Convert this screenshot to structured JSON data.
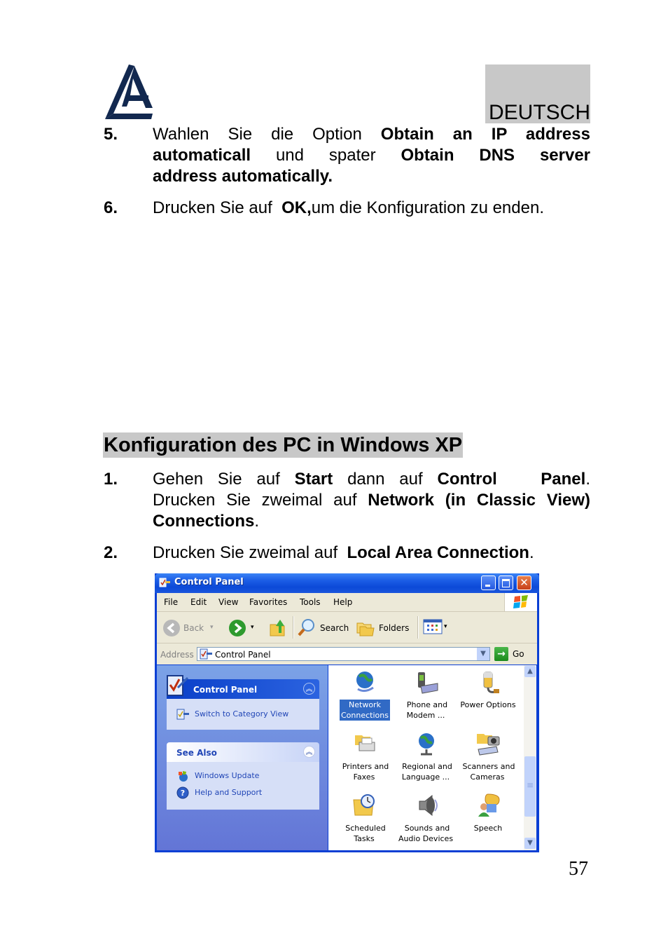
{
  "header": {
    "language": "DEUTSCH",
    "logo": "atlantis-logo"
  },
  "steps_top": [
    {
      "number": "5.",
      "lines": [
        [
          {
            "t": "Wahlen Sie die Option ",
            "b": false
          },
          {
            "t": "Obtain an IP address",
            "b": true
          }
        ],
        [
          {
            "t": "automaticall",
            "b": true
          },
          {
            "t": " und spater ",
            "b": false
          },
          {
            "t": "Obtain DNS server",
            "b": true
          }
        ],
        [
          {
            "t": "address automatically.",
            "b": true
          }
        ]
      ]
    },
    {
      "number": "6.",
      "lines": [
        [
          {
            "t": "Drucken Sie auf  ",
            "b": false
          },
          {
            "t": "OK,",
            "b": true
          },
          {
            "t": "um die Konfiguration zu enden.",
            "b": false
          }
        ]
      ]
    }
  ],
  "section_title": "Konfiguration des PC in Windows XP",
  "steps_bottom": [
    {
      "number": "1.",
      "lines": [
        [
          {
            "t": "Gehen Sie auf ",
            "b": false
          },
          {
            "t": "Start",
            "b": true
          },
          {
            "t": " dann auf ",
            "b": false
          },
          {
            "t": "Control   Panel",
            "b": true
          },
          {
            "t": ".",
            "b": false
          }
        ],
        [
          {
            "t": "Drucken Sie zweimal auf ",
            "b": false
          },
          {
            "t": "Network (in Classic View)",
            "b": true
          }
        ],
        [
          {
            "t": "Connections",
            "b": true
          },
          {
            "t": ".",
            "b": false
          }
        ]
      ]
    },
    {
      "number": "2.",
      "lines": [
        [
          {
            "t": "Drucken Sie zweimal auf  ",
            "b": false
          },
          {
            "t": "Local Area Connection",
            "b": true
          },
          {
            "t": ".",
            "b": false
          }
        ]
      ]
    }
  ],
  "window": {
    "title": "Control Panel",
    "menu": [
      "File",
      "Edit",
      "View",
      "Favorites",
      "Tools",
      "Help"
    ],
    "toolbar": {
      "back": "Back",
      "search": "Search",
      "folders": "Folders"
    },
    "address": {
      "label": "Address",
      "value": "Control Panel",
      "go": "Go"
    },
    "taskpane": {
      "control_panel": {
        "title": "Control Panel",
        "links": [
          "Switch to Category View"
        ]
      },
      "see_also": {
        "title": "See Also",
        "links": [
          "Windows Update",
          "Help and Support"
        ]
      }
    },
    "items": [
      {
        "label_1": "Network",
        "label_2": "Connections",
        "icon": "network-connections-icon",
        "selected": true
      },
      {
        "label_1": "Phone and",
        "label_2": "Modem ...",
        "icon": "phone-modem-icon",
        "selected": false
      },
      {
        "label_1": "Power Options",
        "label_2": "",
        "icon": "power-options-icon",
        "selected": false
      },
      {
        "label_1": "Printers and",
        "label_2": "Faxes",
        "icon": "printers-faxes-icon",
        "selected": false
      },
      {
        "label_1": "Regional and",
        "label_2": "Language ...",
        "icon": "regional-language-icon",
        "selected": false
      },
      {
        "label_1": "Scanners and",
        "label_2": "Cameras",
        "icon": "scanners-cameras-icon",
        "selected": false
      },
      {
        "label_1": "Scheduled",
        "label_2": "Tasks",
        "icon": "scheduled-tasks-icon",
        "selected": false
      },
      {
        "label_1": "Sounds and",
        "label_2": "Audio Devices",
        "icon": "sounds-audio-icon",
        "selected": false
      },
      {
        "label_1": "Speech",
        "label_2": "",
        "icon": "speech-icon",
        "selected": false
      }
    ],
    "colors": {
      "titlebar": "#0c4ad8",
      "selection": "#316ac5",
      "link": "#2146b6"
    }
  },
  "page_number": "57"
}
